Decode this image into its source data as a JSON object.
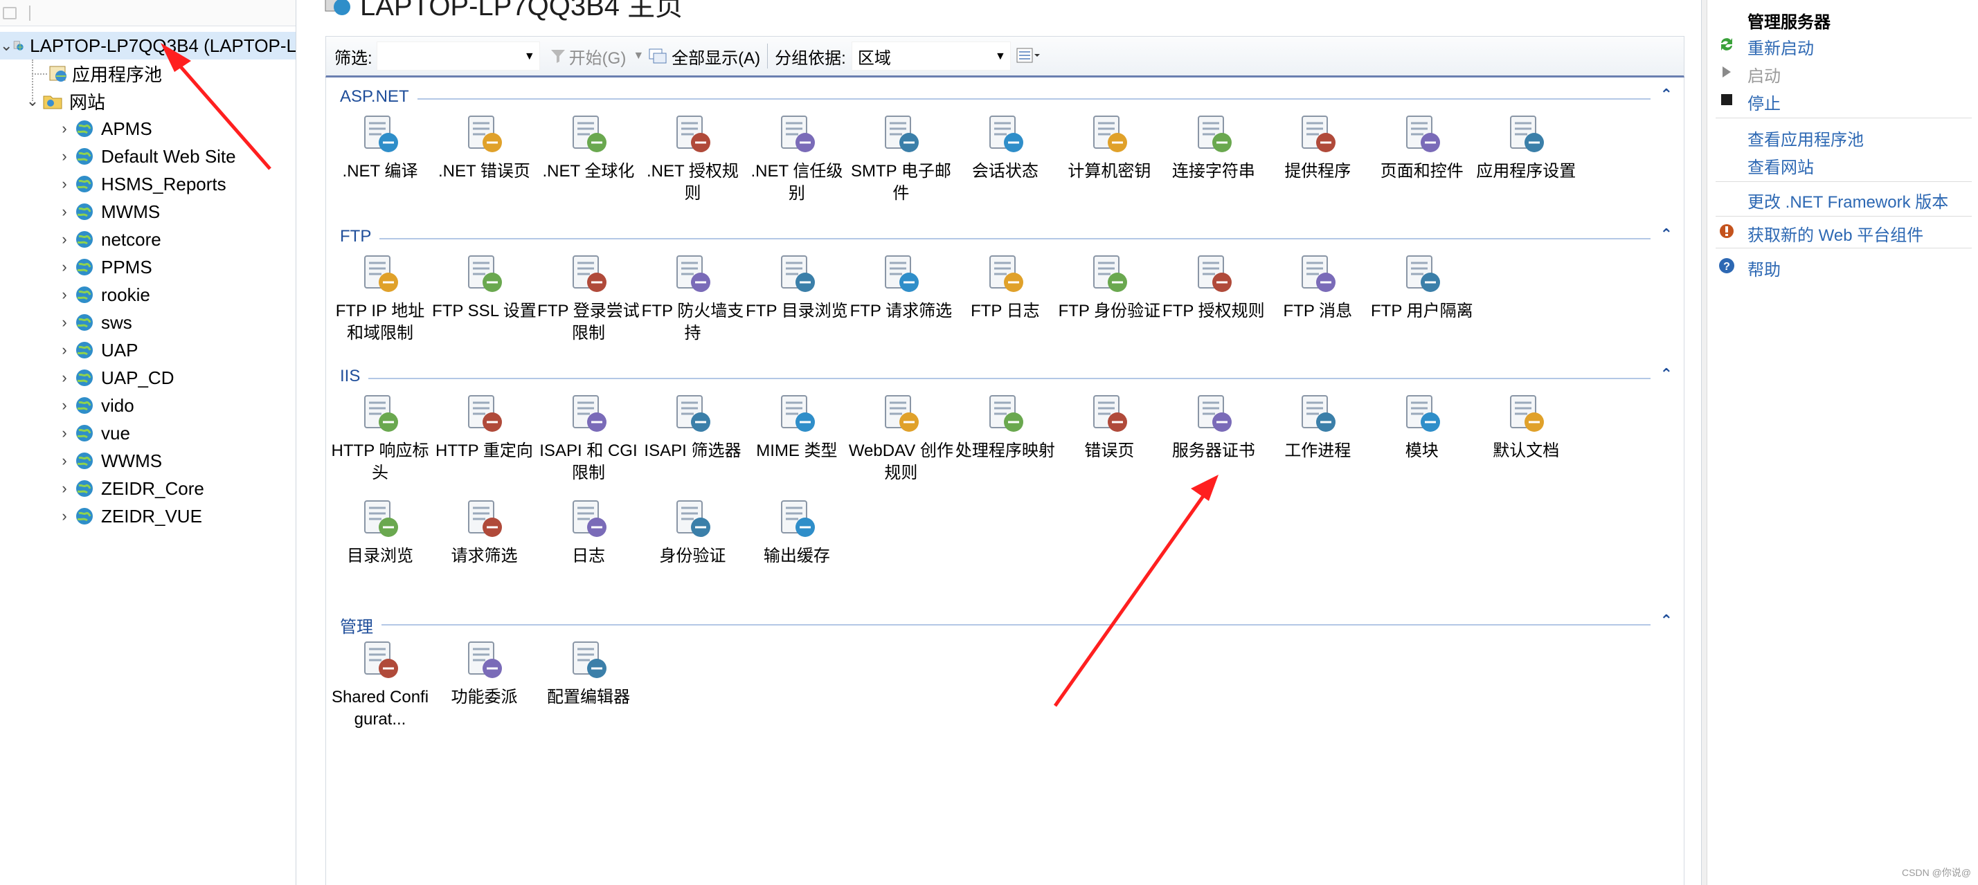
{
  "tree": {
    "root": "LAPTOP-LP7QQ3B4 (LAPTOP-L",
    "app_pools": "应用程序池",
    "sites": "网站",
    "site_items": [
      "APMS",
      "Default Web Site",
      "HSMS_Reports",
      "MWMS",
      "netcore",
      "PPMS",
      "rookie",
      "sws",
      "UAP",
      "UAP_CD",
      "vido",
      "vue",
      "WWMS",
      "ZEIDR_Core",
      "ZEIDR_VUE"
    ]
  },
  "header": {
    "title": "LAPTOP-LP7QQ3B4 主页"
  },
  "filterbar": {
    "filter_label": "筛选:",
    "filter_value": "",
    "go_label": "开始(G)",
    "show_all_label": "全部显示(A)",
    "group_label": "分组依据:",
    "group_value": "区域"
  },
  "groups": [
    {
      "name": "ASP.NET",
      "items": [
        {
          "label": ".NET 编译",
          "icon": "net-compile-icon"
        },
        {
          "label": ".NET 错误页",
          "icon": "net-error-pages-icon"
        },
        {
          "label": ".NET 全球化",
          "icon": "globe-icon"
        },
        {
          "label": ".NET 授权规则",
          "icon": "authorization-icon"
        },
        {
          "label": ".NET 信任级别",
          "icon": "trust-level-icon"
        },
        {
          "label": "SMTP 电子邮件",
          "icon": "smtp-icon"
        },
        {
          "label": "会话状态",
          "icon": "session-state-icon"
        },
        {
          "label": "计算机密钥",
          "icon": "machine-key-icon"
        },
        {
          "label": "连接字符串",
          "icon": "connection-strings-icon"
        },
        {
          "label": "提供程序",
          "icon": "providers-icon"
        },
        {
          "label": "页面和控件",
          "icon": "pages-controls-icon"
        },
        {
          "label": "应用程序设置",
          "icon": "app-settings-icon"
        }
      ]
    },
    {
      "name": "FTP",
      "items": [
        {
          "label": "FTP IP 地址和域限制",
          "icon": "ftp-ip-icon"
        },
        {
          "label": "FTP SSL 设置",
          "icon": "ftp-ssl-icon"
        },
        {
          "label": "FTP 登录尝试限制",
          "icon": "ftp-logon-icon"
        },
        {
          "label": "FTP 防火墙支持",
          "icon": "ftp-firewall-icon"
        },
        {
          "label": "FTP 目录浏览",
          "icon": "ftp-dirbrowse-icon"
        },
        {
          "label": "FTP 请求筛选",
          "icon": "ftp-request-filter-icon"
        },
        {
          "label": "FTP 日志",
          "icon": "ftp-log-icon"
        },
        {
          "label": "FTP 身份验证",
          "icon": "ftp-auth-icon"
        },
        {
          "label": "FTP 授权规则",
          "icon": "ftp-authz-icon"
        },
        {
          "label": "FTP 消息",
          "icon": "ftp-messages-icon"
        },
        {
          "label": "FTP 用户隔离",
          "icon": "ftp-user-isolation-icon"
        }
      ]
    },
    {
      "name": "IIS",
      "items": [
        {
          "label": "HTTP 响应标头",
          "icon": "http-headers-icon"
        },
        {
          "label": "HTTP 重定向",
          "icon": "http-redirect-icon"
        },
        {
          "label": "ISAPI 和 CGI 限制",
          "icon": "isapi-cgi-icon"
        },
        {
          "label": "ISAPI 筛选器",
          "icon": "isapi-filters-icon"
        },
        {
          "label": "MIME 类型",
          "icon": "mime-types-icon"
        },
        {
          "label": "WebDAV 创作规则",
          "icon": "webdav-icon"
        },
        {
          "label": "处理程序映射",
          "icon": "handler-mappings-icon"
        },
        {
          "label": "错误页",
          "icon": "error-pages-icon"
        },
        {
          "label": "服务器证书",
          "icon": "server-certificates-icon"
        },
        {
          "label": "工作进程",
          "icon": "worker-processes-icon"
        },
        {
          "label": "模块",
          "icon": "modules-icon"
        },
        {
          "label": "默认文档",
          "icon": "default-document-icon"
        },
        {
          "label": "目录浏览",
          "icon": "directory-browsing-icon"
        },
        {
          "label": "请求筛选",
          "icon": "request-filtering-icon"
        },
        {
          "label": "日志",
          "icon": "logging-icon"
        },
        {
          "label": "身份验证",
          "icon": "authentication-icon"
        },
        {
          "label": "输出缓存",
          "icon": "output-caching-icon"
        }
      ]
    },
    {
      "name": "管理",
      "items": [
        {
          "label": "Shared Configurat...",
          "icon": "shared-config-icon"
        },
        {
          "label": "功能委派",
          "icon": "feature-delegation-icon"
        },
        {
          "label": "配置编辑器",
          "icon": "config-editor-icon"
        }
      ]
    }
  ],
  "actions": {
    "header": "管理服务器",
    "restart": "重新启动",
    "start": "启动",
    "stop": "停止",
    "view_app_pools": "查看应用程序池",
    "view_sites": "查看网站",
    "change_framework": "更改 .NET Framework 版本",
    "get_components": "获取新的 Web 平台组件",
    "help": "帮助"
  },
  "footer": "CSDN @你说@",
  "colors": {
    "link": "#2d68b3",
    "group_title": "#1f4e9a",
    "annotation_arrow": "#ff1f1f"
  }
}
